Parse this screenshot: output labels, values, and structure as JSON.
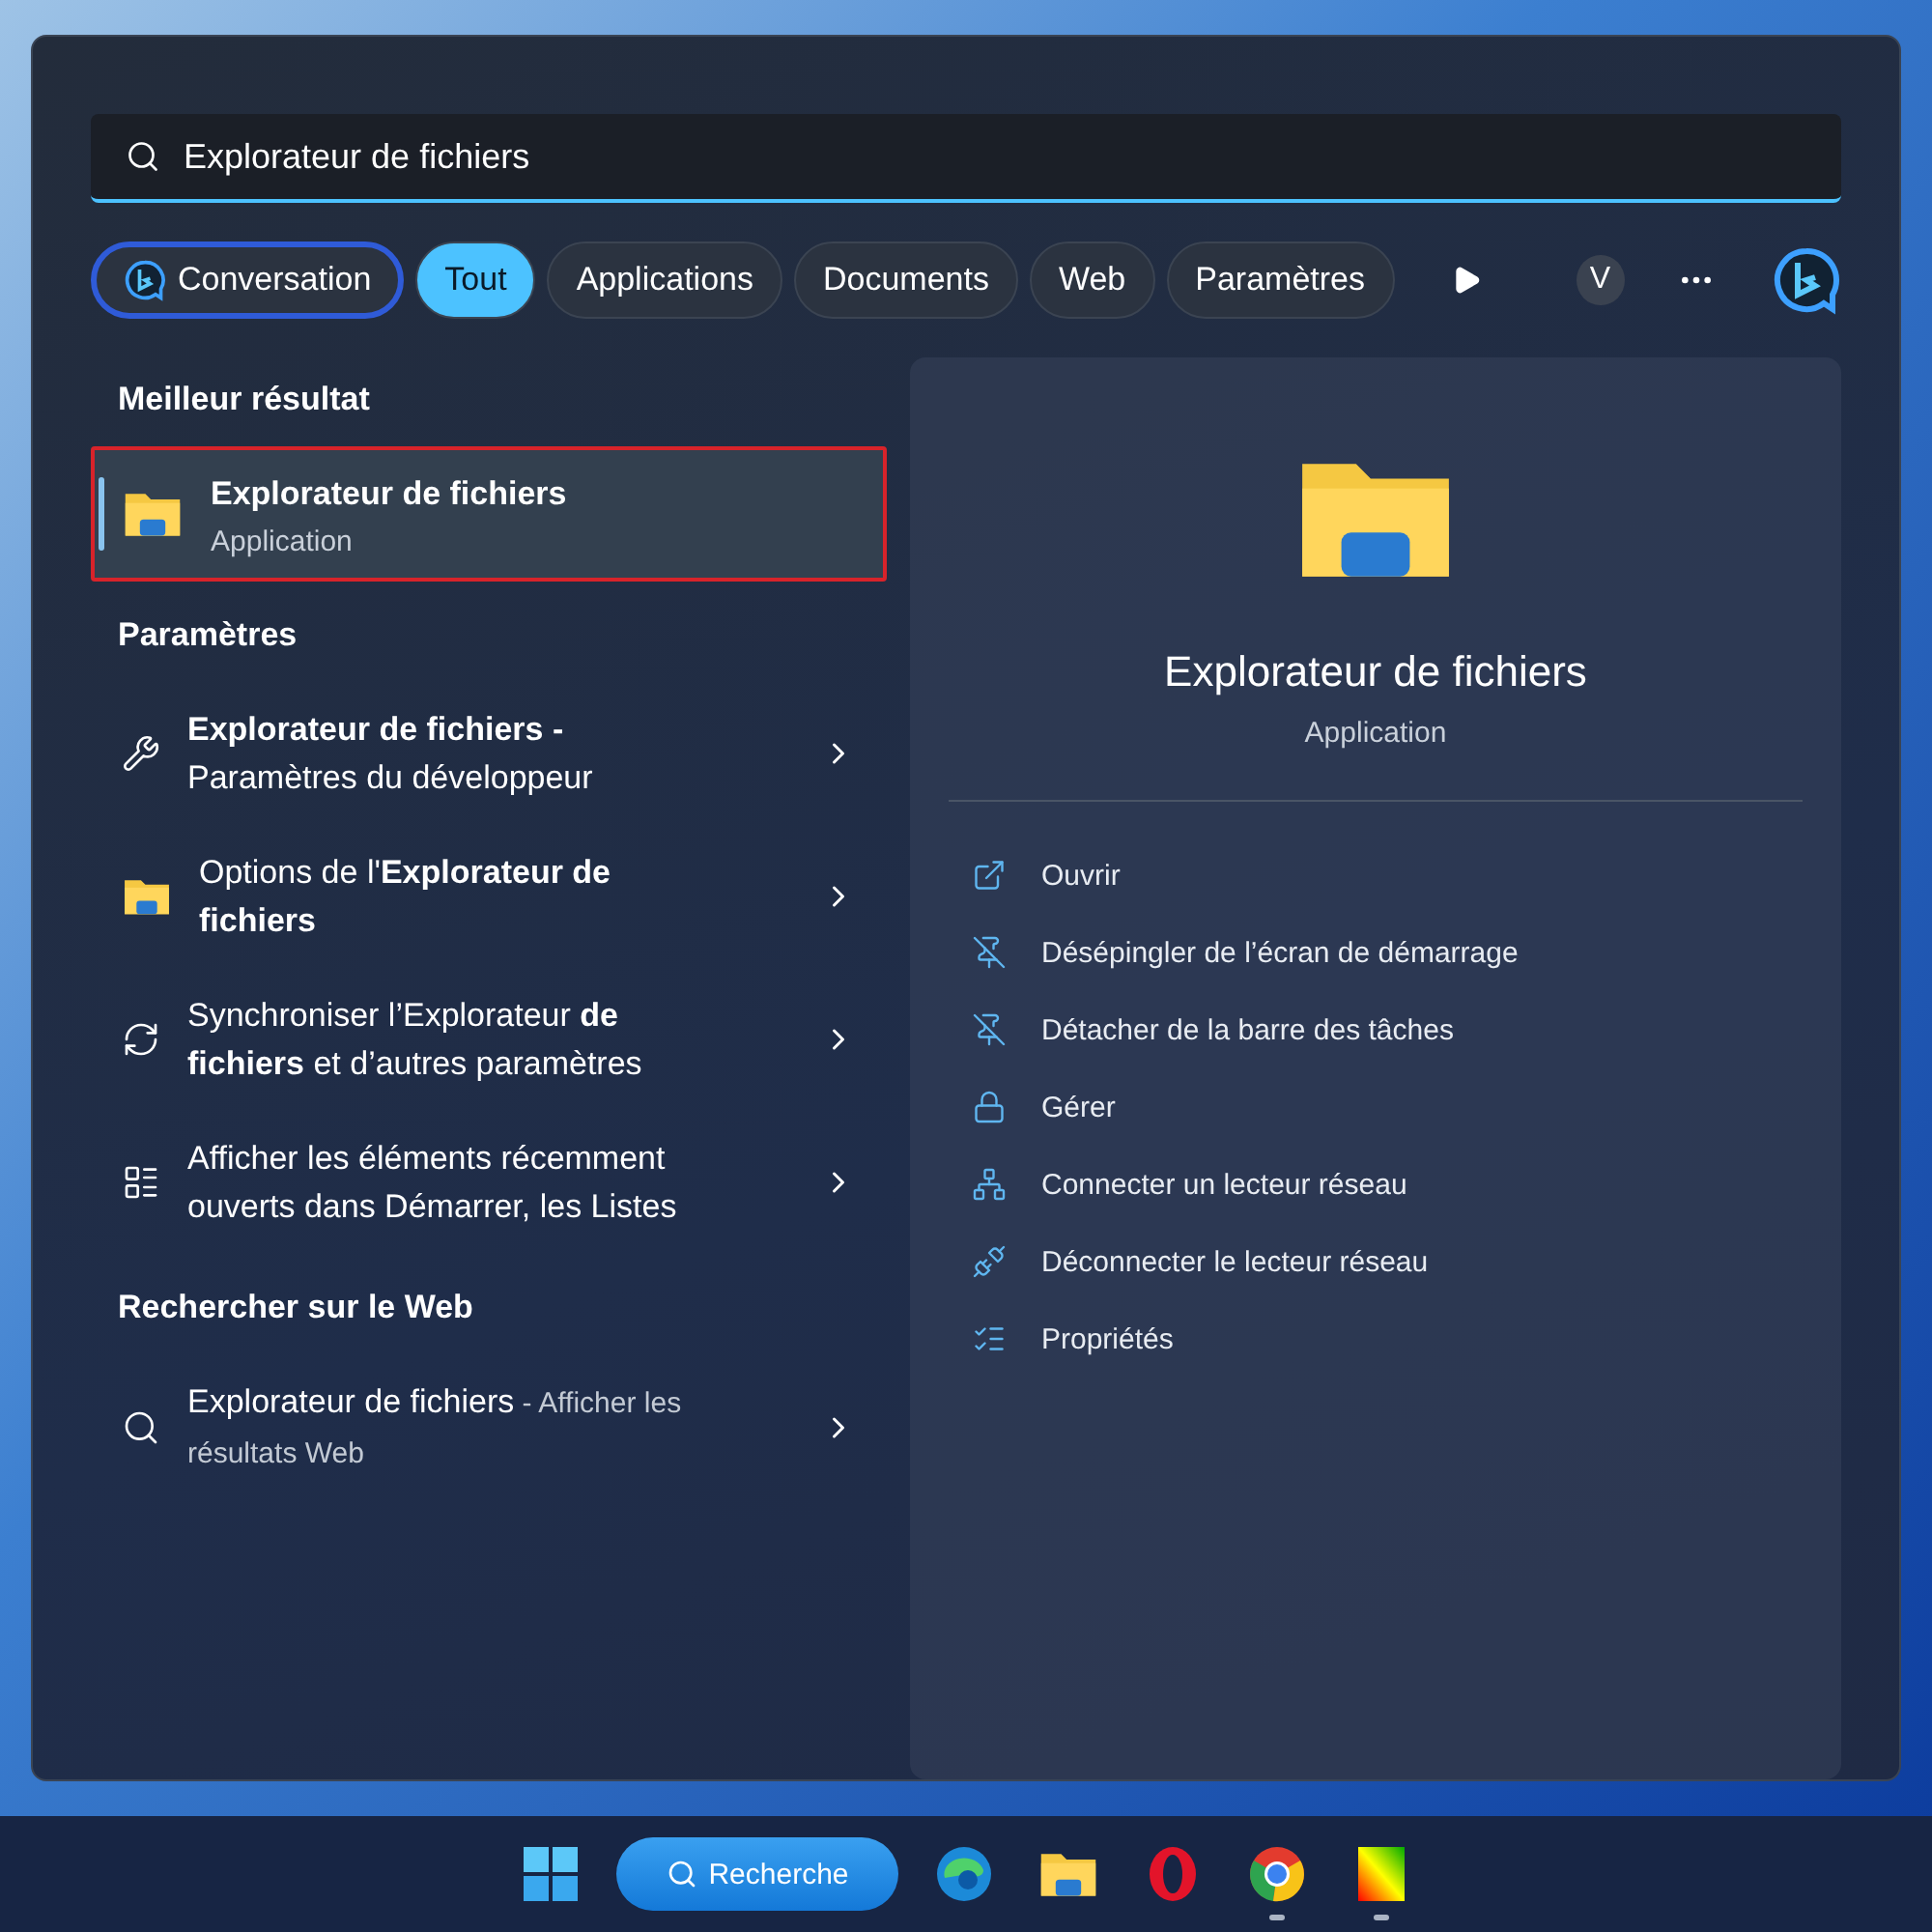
{
  "search": {
    "value": "Explorateur de fichiers"
  },
  "filters": [
    {
      "label": "Conversation",
      "kind": "chat",
      "selected": false
    },
    {
      "label": "Tout",
      "kind": "chip",
      "selected": true
    },
    {
      "label": "Applications",
      "kind": "chip",
      "selected": false
    },
    {
      "label": "Documents",
      "kind": "chip",
      "selected": false
    },
    {
      "label": "Web",
      "kind": "chip",
      "selected": false
    },
    {
      "label": "Paramètres",
      "kind": "chip",
      "selected": false
    }
  ],
  "account_initial": "V",
  "sections": [
    {
      "heading": "Meilleur résultat",
      "items": [
        {
          "kind": "app",
          "title": "Explorateur de fichiers",
          "subtitle": "Application",
          "selected": true
        }
      ]
    },
    {
      "heading": "Paramètres",
      "items": [
        {
          "kind": "tools",
          "title": "**Explorateur de fichiers -** Paramètres du développeur",
          "selected": false
        },
        {
          "kind": "folder-options",
          "title": "Options de l'**Explorateur de fichiers**",
          "selected": false
        },
        {
          "kind": "sync",
          "title": "Synchroniser l’Explorateur **de fichiers** et d’autres paramètres",
          "selected": false
        },
        {
          "kind": "list",
          "title": "Afficher les éléments récemment ouverts dans Démarrer, les Listes",
          "selected": false
        }
      ]
    },
    {
      "heading": "Rechercher sur le Web",
      "items": [
        {
          "kind": "web",
          "title": "Explorateur de fichiers",
          "suffix": " - Afficher les résultats Web",
          "selected": false
        }
      ]
    }
  ],
  "preview": {
    "title": "Explorateur de fichiers",
    "subtitle": "Application",
    "actions": [
      {
        "kind": "open",
        "label": "Ouvrir"
      },
      {
        "kind": "unpin",
        "label": "Désépingler de l’écran de démarrage"
      },
      {
        "kind": "unpin",
        "label": "Détacher de la barre des tâches"
      },
      {
        "kind": "manage",
        "label": "Gérer"
      },
      {
        "kind": "map-drive",
        "label": "Connecter un lecteur réseau"
      },
      {
        "kind": "disconnect-drive",
        "label": "Déconnecter le lecteur réseau"
      },
      {
        "kind": "properties",
        "label": "Propriétés"
      }
    ]
  },
  "taskbar": {
    "search_label": "Recherche",
    "apps": [
      {
        "kind": "edge",
        "running": false
      },
      {
        "kind": "folder",
        "running": false
      },
      {
        "kind": "opera",
        "running": false
      },
      {
        "kind": "chrome",
        "running": true
      },
      {
        "kind": "gradient",
        "running": true
      }
    ]
  }
}
